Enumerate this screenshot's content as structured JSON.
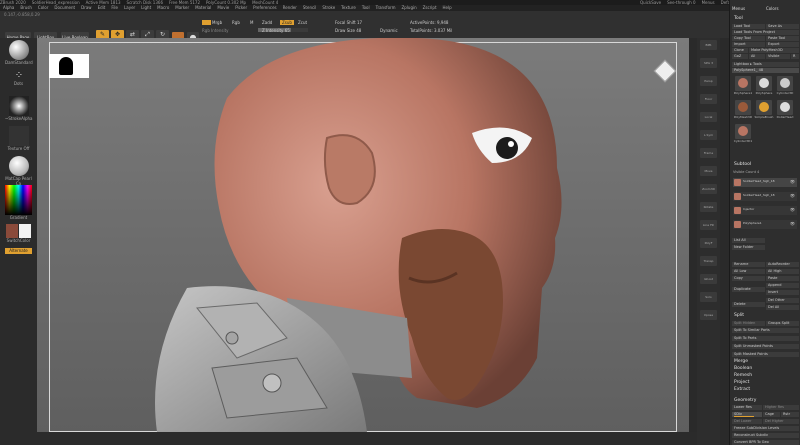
{
  "titlebar": {
    "items": [
      "ZBrush 2020",
      "SoldierHead_expression",
      "Active Mem 1813",
      "Scratch Disk 1366",
      "Free Mem 5172",
      "PolyCount 0.302 Mp",
      "MeshCount 4"
    ],
    "right": [
      "QuickSave",
      "See-through 0",
      "Menus",
      "DefaultZScript"
    ]
  },
  "menubar": {
    "items": [
      "Alpha",
      "Brush",
      "Color",
      "Document",
      "Draw",
      "Edit",
      "File",
      "Layer",
      "Light",
      "Macro",
      "Marker",
      "Material",
      "Movie",
      "Picker",
      "Preferences",
      "Render",
      "Stencil",
      "Stroke",
      "Texture",
      "Tool",
      "Transform",
      "Zplugin",
      "Zscript",
      "Help"
    ]
  },
  "toolbar": {
    "coords": "0.147,-0.858,0.29",
    "home_page": "Home Page",
    "lightbox": "LightBox",
    "live_boolean": "Live Boolean",
    "modes": [
      {
        "icon": "✎",
        "label": "Edit",
        "active": true
      },
      {
        "icon": "✥",
        "label": "Draw",
        "active": true
      },
      {
        "icon": "⇄",
        "label": "Move",
        "active": false
      },
      {
        "icon": "⤢",
        "label": "Scale",
        "active": false
      },
      {
        "icon": "↻",
        "label": "Rotate",
        "active": false
      }
    ],
    "mrgb": "Mrgb",
    "rgb": "Rgb",
    "m": "M",
    "zadd": "Zadd",
    "zsub": "Zsub",
    "zcut": "Zcut",
    "rgb_intensity": "Rgb Intensity",
    "z_intensity": "Z Intensity 65",
    "focal_shift": "Focal Shift 17",
    "draw_size": "Draw Size 48",
    "dynamic": "Dynamic",
    "active_points": "ActivePoints: 9,948",
    "total_points": "TotalPoints: 3.037 Mil"
  },
  "leftshelf": {
    "brush": "DamStandard",
    "stroke": "Dots",
    "alpha": "~StrokeAlpha",
    "texture": "Texture Off",
    "material": "MatCap Pearl Ca",
    "gradient": "Gradient",
    "switch_color": "SwitchColor",
    "alternate": "Alternate"
  },
  "rightshelf": [
    "BPR",
    "SPix 3",
    "Persp",
    "Floor",
    "Local",
    "L.Sym",
    "Frame",
    "Move",
    "Zoom3D",
    "Rotate",
    "Line Fill",
    "PolyF",
    "Transp",
    "Ghost",
    "Solo",
    "Xpose"
  ],
  "panel": {
    "header": "Tool",
    "menus": "Menus",
    "colors": "Colors",
    "load_tool": "Load Tool",
    "save_as": "Save As",
    "load_from_project": "Load Tools From Project",
    "copy_tool": "Copy Tool",
    "paste_tool": "Paste Tool",
    "import": "Import",
    "export": "Export",
    "clone": "Clone",
    "make_polymesh": "Make PolyMesh3D",
    "goz": "GoZ",
    "all": "All",
    "visible": "Visible",
    "r": "R",
    "lightbox_tools": "Lightbox ▸ Tools",
    "current_tool": "PolySphere1_ 48",
    "tools": [
      "PolySphere1",
      "PolySphere",
      "Cylinder3D",
      "PolyMesh3D",
      "SimpleBrush",
      "DollarHead",
      "Cylinder3D1"
    ],
    "subtool_header": "Subtool",
    "visible_count": "Visible Count 4",
    "subtools": [
      "SoldierHead_high_18",
      "SoldierHead_high_18",
      "Injector",
      "PolySphere1"
    ],
    "list_all": "List All",
    "new_folder": "New Folder",
    "rename": "Rename",
    "auto_reorder": "AutoReorder",
    "all_low": "All Low",
    "all_high": "All High",
    "copy": "Copy",
    "paste": "Paste",
    "duplicate": "Duplicate",
    "append": "Append",
    "insert": "Insert",
    "delete": "Delete",
    "del_other": "Del Other",
    "del_all": "Del All",
    "split_header": "Split",
    "split_hidden": "Split Hidden",
    "groups_split": "Groups Split",
    "split_similar": "Split To Similar Parts",
    "split_parts": "Split To Parts",
    "split_unmasked": "Split Unmasked Points",
    "split_masked": "Split Masked Points",
    "merge": "Merge",
    "boolean": "Boolean",
    "remesh": "Remesh",
    "project": "Project",
    "extract": "Extract",
    "geometry": "Geometry",
    "lower_res": "Lower Res",
    "higher_res": "Higher Res",
    "sdiv": "SDiv",
    "cage": "Cage",
    "rstr": "Rstr",
    "del_lower": "Del Lower",
    "del_higher": "Del Higher",
    "freeze": "Freeze SubDivision Levels",
    "reconstruct": "Reconstruct Subdiv",
    "convert": "Convert BPR To Geo"
  },
  "colors": {
    "accent": "#e0a030",
    "skin": "#c48470",
    "nose_clay": "#7b4a35",
    "armor": "#a8a8a8",
    "viewport_bg": "#737373"
  }
}
